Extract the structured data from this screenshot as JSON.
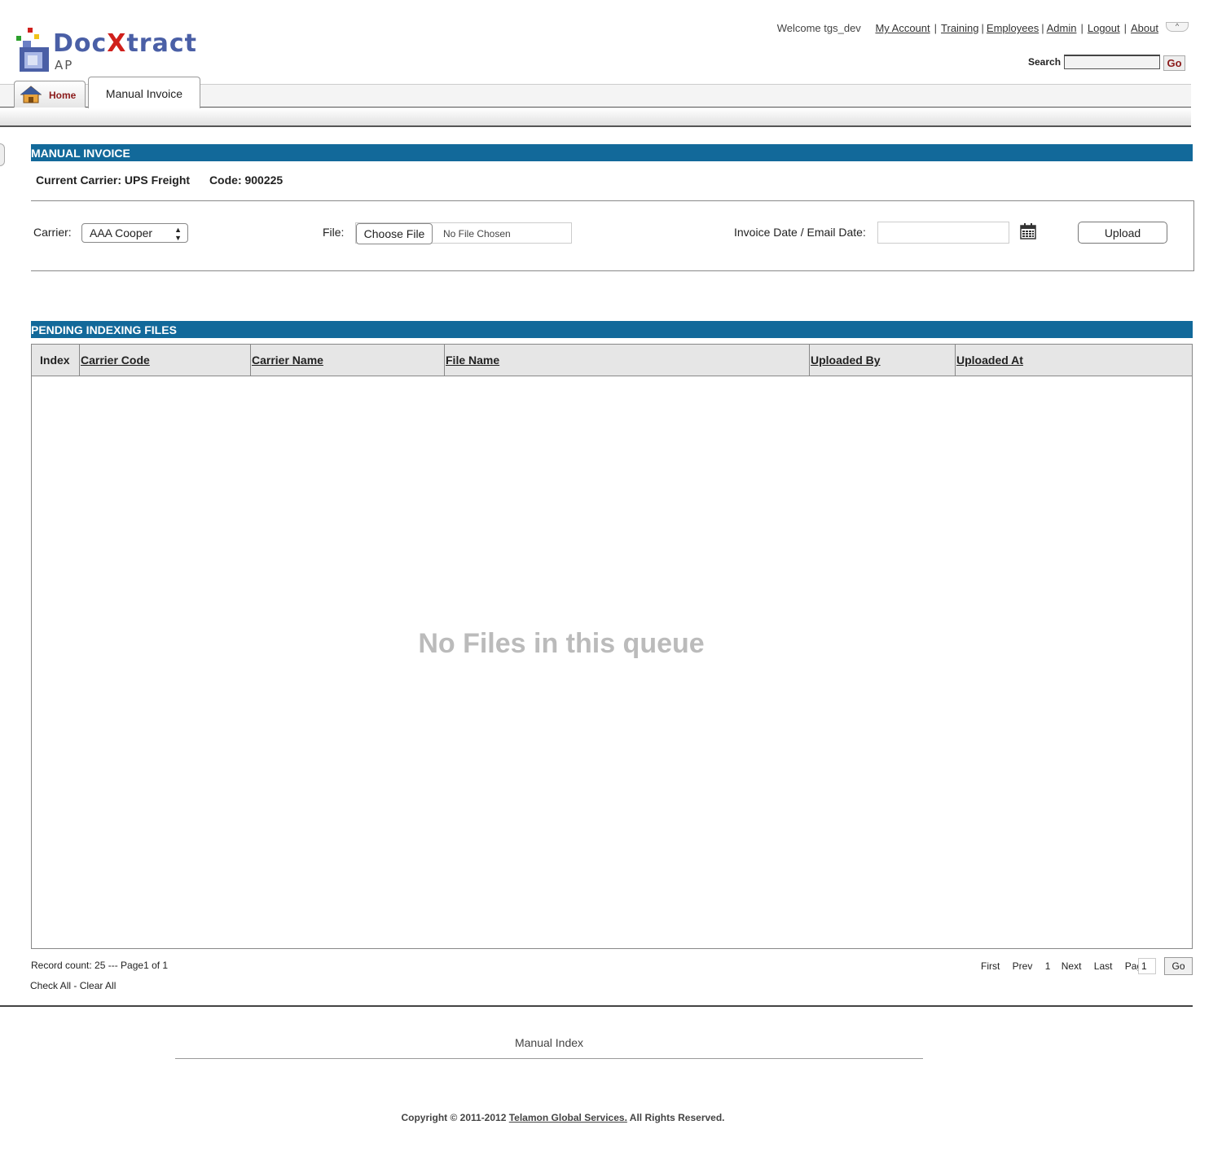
{
  "brand": {
    "logo_doc": "Doc",
    "logo_x": "X",
    "logo_tract": "tract",
    "logo_sub": "AP"
  },
  "header": {
    "welcome": "Welcome tgs_dev",
    "links": [
      "My Account",
      "Training",
      "Employees",
      "Admin",
      "Logout",
      "About"
    ],
    "search_label": "Search",
    "search_value": "",
    "search_go": "Go",
    "collapse_glyph": "^"
  },
  "tabs": {
    "home": "Home",
    "manual_invoice": "Manual Invoice"
  },
  "manual_invoice": {
    "section_title": "MANUAL INVOICE",
    "current_carrier": "Current Carrier: UPS Freight",
    "code": "Code: 900225",
    "carrier_label": "Carrier:",
    "carrier_value": "AAA Cooper",
    "file_label": "File:",
    "choose_file": "Choose File",
    "no_file": "No File Chosen",
    "date_label": "Invoice Date / Email Date:",
    "date_value": "",
    "upload": "Upload"
  },
  "pending": {
    "section_title": "PENDING INDEXING FILES",
    "columns": [
      "Index",
      "Carrier Code",
      "Carrier Name",
      "File Name",
      "Uploaded By",
      "Uploaded At"
    ],
    "empty_message": "No Files in this queue",
    "record_count": "Record count: 25  --- Page1 of 1",
    "check_all": "Check All",
    "clear_all": "Clear All",
    "pager": {
      "first": "First",
      "prev": "Prev",
      "current": "1",
      "next": "Next",
      "last": "Last",
      "page_label": "Page",
      "page_value": "1",
      "go": "Go"
    }
  },
  "footer": {
    "nav": "Manual Index",
    "copyright_prefix": "Copyright © 2011-2012",
    "company": "Telamon Global Services.",
    "copyright_suffix": "All Rights Reserved."
  },
  "colors": {
    "section_header": "#12699a",
    "home_tab_text": "#8b1a1a",
    "logo_blue": "#4a5fa6",
    "logo_red": "#d0201c"
  }
}
